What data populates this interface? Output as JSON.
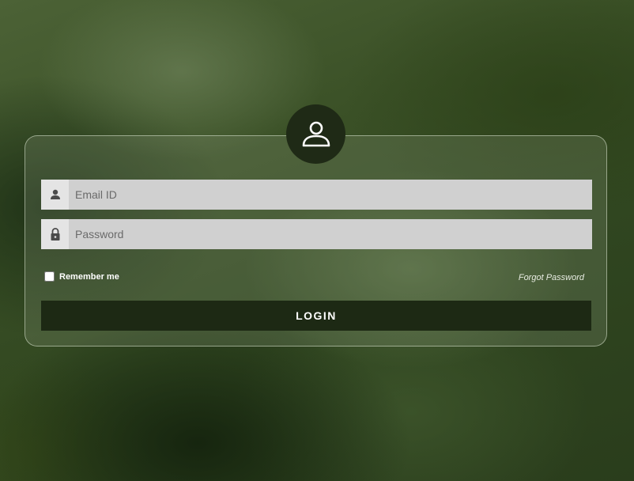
{
  "colors": {
    "card_border": "#dce6d2",
    "avatar_bg": "#1f2a16",
    "input_bg": "#d0d0d0",
    "input_icon_bg": "#e4e4e4",
    "button_bg": "#1d2914",
    "button_text": "#ffffff"
  },
  "avatar": {
    "icon": "user-outline-icon"
  },
  "form": {
    "email": {
      "icon": "user-icon",
      "placeholder": "Email ID",
      "value": ""
    },
    "password": {
      "icon": "lock-icon",
      "placeholder": "Password",
      "value": ""
    },
    "remember_label": "Remember me",
    "remember_checked": false,
    "forgot_label": "Forgot Password",
    "login_label": "LOGIN"
  }
}
